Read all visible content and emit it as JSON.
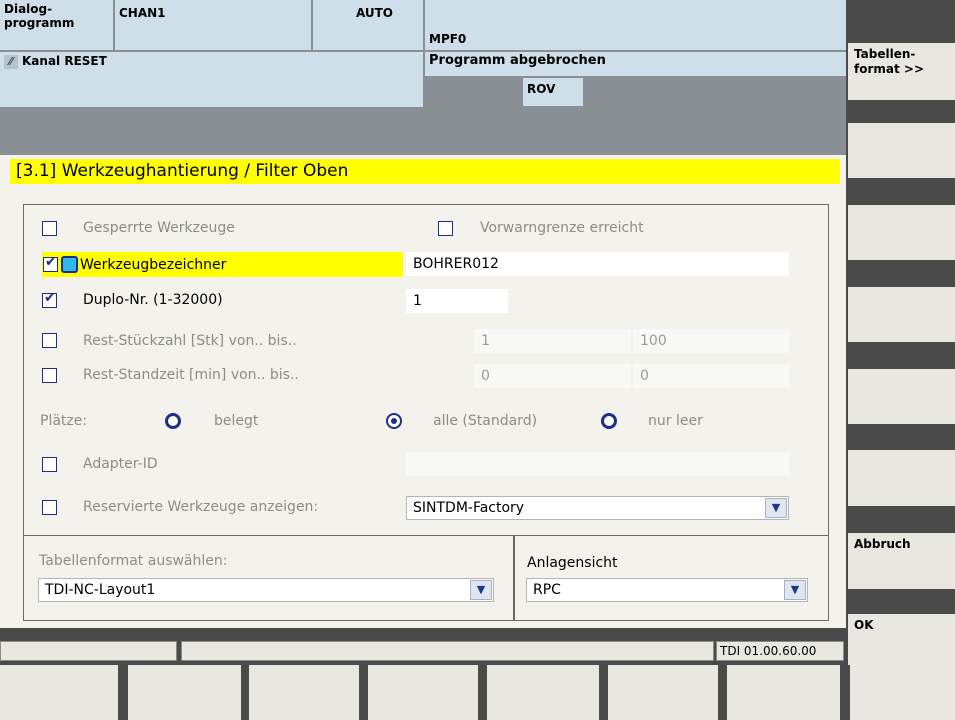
{
  "header": {
    "dialog_label": "Dialog-\nprogramm",
    "channel": "CHAN1",
    "mode": "AUTO",
    "program": "MPF0",
    "channel_status": "Kanal RESET",
    "program_status": "Programm abgebrochen",
    "rov": "ROV"
  },
  "title_bar": "[3.1] Werkzeughantierung / Filter Oben",
  "filters": {
    "locked_tools": "Gesperrte Werkzeuge",
    "prewarning": "Vorwarngrenze erreicht",
    "tool_identifier": "Werkzeugbezeichner",
    "tool_identifier_value": "BOHRER012",
    "duplo": "Duplo-Nr. (1-32000)",
    "duplo_value": "1",
    "rest_count": "Rest-Stückzahl [Stk] von.. bis..",
    "rest_count_from": "1",
    "rest_count_to": "100",
    "rest_time": "Rest-Standzeit [min] von.. bis..",
    "rest_time_from": "0",
    "rest_time_to": "0",
    "places_label": "Plätze:",
    "places_occupied": "belegt",
    "places_all": "alle (Standard)",
    "places_empty": "nur leer",
    "adapter_id": "Adapter-ID",
    "reserved_tools": "Reservierte Werkzeuge anzeigen:",
    "reserved_value": "SINTDM-Factory"
  },
  "table_format": {
    "label": "Tabellenformat auswählen:",
    "value": "TDI-NC-Layout1"
  },
  "plant_view": {
    "label": "Anlagensicht",
    "value": "RPC"
  },
  "status_bar": {
    "version": "TDI 01.00.60.00"
  },
  "softkeys": {
    "table_format": "Tabellen-\nformat >>",
    "cancel": "Abbruch",
    "ok": "OK"
  },
  "colors": {
    "title_bar": "#ffff00",
    "header": "#cfdfea",
    "accent": "#1a2f8a"
  }
}
